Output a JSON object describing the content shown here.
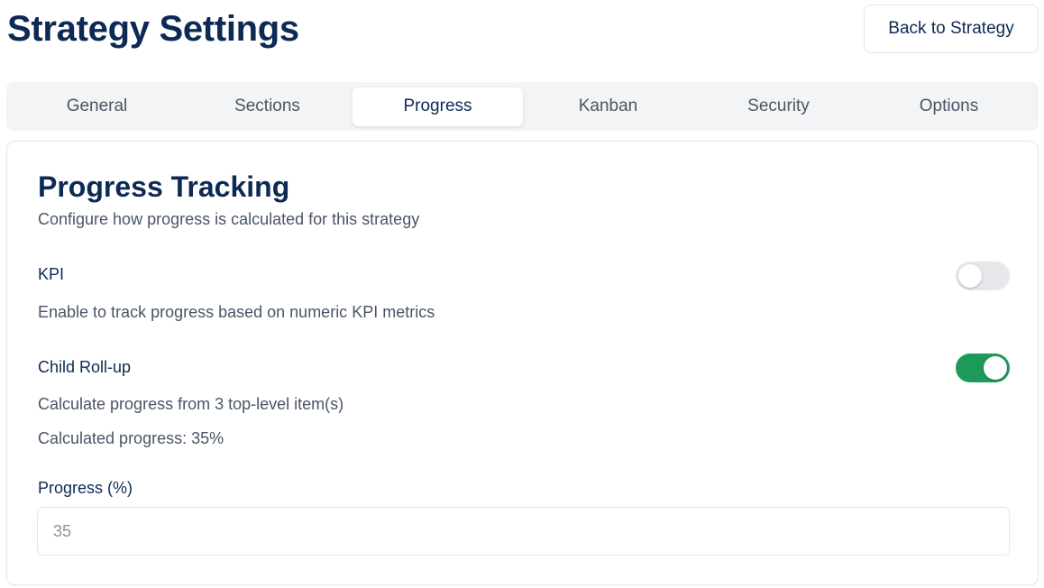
{
  "header": {
    "title": "Strategy Settings",
    "back_label": "Back to Strategy"
  },
  "tabs": [
    {
      "label": "General",
      "active": false
    },
    {
      "label": "Sections",
      "active": false
    },
    {
      "label": "Progress",
      "active": true
    },
    {
      "label": "Kanban",
      "active": false
    },
    {
      "label": "Security",
      "active": false
    },
    {
      "label": "Options",
      "active": false
    }
  ],
  "card": {
    "title": "Progress Tracking",
    "subtitle": "Configure how progress is calculated for this strategy",
    "kpi": {
      "label": "KPI",
      "description": "Enable to track progress based on numeric KPI metrics",
      "enabled": false
    },
    "child_rollup": {
      "label": "Child Roll-up",
      "description": "Calculate progress from 3 top-level item(s)",
      "calculated": "Calculated progress: 35%",
      "enabled": true
    },
    "progress_field": {
      "label": "Progress (%)",
      "placeholder": "35"
    }
  },
  "colors": {
    "toggle_on": "#1d9a57",
    "toggle_off": "#e5e7eb",
    "title": "#0d2a55"
  }
}
